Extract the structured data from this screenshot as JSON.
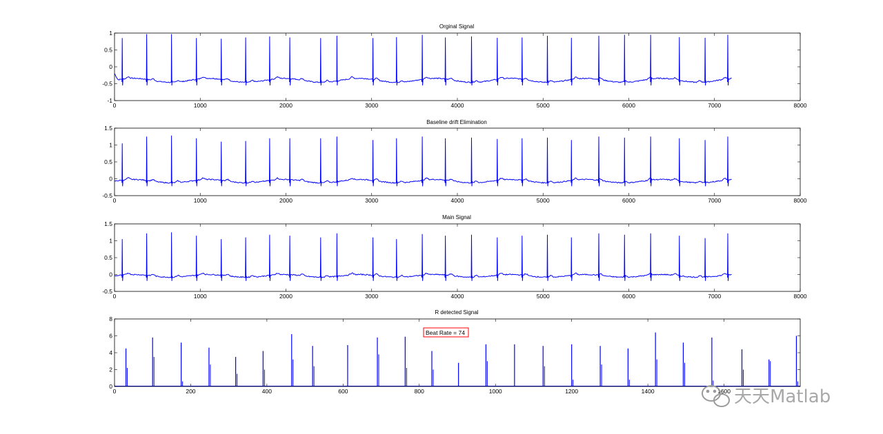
{
  "chart_data": [
    {
      "type": "line",
      "title": "Orginal Signal",
      "xlim": [
        0,
        8000
      ],
      "ylim": [
        -1,
        1
      ],
      "xticks": [
        0,
        1000,
        2000,
        3000,
        4000,
        5000,
        6000,
        7000,
        8000
      ],
      "yticks": [
        -1,
        -0.5,
        0,
        0.5,
        1
      ],
      "series_color": "#0000ff",
      "signal": {
        "x_end": 7200,
        "r_peaks_x": [
          90,
          375,
          665,
          955,
          1245,
          1530,
          1810,
          2045,
          2405,
          2595,
          3015,
          3290,
          3590,
          3860,
          4165,
          4465,
          4755,
          5050,
          5330,
          5650,
          5950,
          6255,
          6590,
          6890,
          7155
        ],
        "r_peaks_y": [
          0.85,
          0.97,
          0.97,
          0.85,
          0.83,
          0.87,
          0.9,
          0.87,
          0.85,
          0.92,
          0.85,
          0.88,
          0.95,
          0.87,
          0.9,
          0.86,
          0.87,
          0.92,
          0.86,
          0.92,
          0.95,
          0.95,
          0.88,
          0.86,
          0.95
        ],
        "baseline": -0.4,
        "baseline_drift": 0.06
      }
    },
    {
      "type": "line",
      "title": "Baseline drift Elimination",
      "xlim": [
        0,
        8000
      ],
      "ylim": [
        -0.5,
        1.5
      ],
      "xticks": [
        0,
        1000,
        2000,
        3000,
        4000,
        5000,
        6000,
        7000,
        8000
      ],
      "yticks": [
        -0.5,
        0,
        0.5,
        1,
        1.5
      ],
      "series_color": "#0000ff",
      "signal": {
        "x_end": 7200,
        "r_peaks_x": [
          90,
          375,
          665,
          955,
          1245,
          1530,
          1810,
          2045,
          2405,
          2595,
          3015,
          3290,
          3590,
          3860,
          4165,
          4465,
          4755,
          5050,
          5330,
          5650,
          5950,
          6255,
          6590,
          6890,
          7155
        ],
        "r_peaks_y": [
          1.05,
          1.25,
          1.28,
          1.2,
          1.1,
          1.12,
          1.2,
          1.2,
          1.2,
          1.25,
          1.15,
          1.2,
          1.25,
          1.2,
          1.22,
          1.18,
          1.2,
          1.22,
          1.15,
          1.25,
          1.22,
          1.25,
          1.2,
          1.15,
          1.25
        ],
        "baseline": -0.07,
        "baseline_drift": 0.05
      }
    },
    {
      "type": "line",
      "title": "Main Signal",
      "xlim": [
        0,
        8000
      ],
      "ylim": [
        -0.5,
        1.5
      ],
      "xticks": [
        0,
        1000,
        2000,
        3000,
        4000,
        5000,
        6000,
        7000,
        8000
      ],
      "yticks": [
        -0.5,
        0,
        0.5,
        1,
        1.5
      ],
      "series_color": "#0000ff",
      "signal": {
        "x_end": 7200,
        "r_peaks_x": [
          90,
          375,
          665,
          955,
          1245,
          1530,
          1810,
          2045,
          2405,
          2595,
          3015,
          3290,
          3590,
          3860,
          4165,
          4465,
          4755,
          5050,
          5330,
          5650,
          5950,
          6255,
          6590,
          6890,
          7155
        ],
        "r_peaks_y": [
          1.05,
          1.22,
          1.25,
          1.15,
          1.05,
          1.1,
          1.18,
          1.15,
          1.1,
          1.22,
          1.1,
          1.05,
          1.2,
          1.15,
          1.18,
          1.1,
          1.15,
          1.18,
          1.1,
          1.22,
          1.18,
          1.22,
          1.15,
          1.08,
          1.22
        ],
        "baseline": -0.04,
        "baseline_drift": 0.04
      }
    },
    {
      "type": "stem",
      "title": "R detected Signal",
      "xlim": [
        0,
        1800
      ],
      "ylim": [
        0,
        8
      ],
      "xticks": [
        0,
        200,
        400,
        600,
        800,
        1000,
        1200,
        1400,
        1600
      ],
      "xtick_labels": [
        "0",
        "200",
        "400",
        "600",
        "800",
        "1000",
        "1200",
        "1400",
        "1600",
        ""
      ],
      "yticks": [
        0,
        2,
        4,
        6,
        8
      ],
      "series_color": "#0000ff",
      "stems": {
        "x": [
          30,
          100,
          175,
          248,
          318,
          390,
          465,
          520,
          612,
          690,
          763,
          833,
          903,
          975,
          1050,
          1125,
          1200,
          1275,
          1348,
          1420,
          1493,
          1568,
          1647,
          1718,
          1790
        ],
        "y": [
          4.5,
          5.8,
          5.2,
          4.6,
          3.5,
          4.2,
          6.2,
          4.8,
          4.9,
          5.8,
          5.9,
          4.2,
          2.8,
          5.0,
          5.0,
          4.8,
          5.0,
          4.8,
          4.5,
          6.4,
          5.2,
          5.8,
          4.4,
          3.2,
          6.0
        ],
        "step_y": [
          2.2,
          3.5,
          0.6,
          2.6,
          1.5,
          2.0,
          3.2,
          2.4,
          0,
          3.8,
          2.2,
          2.0,
          0,
          3.0,
          0,
          2.4,
          0.8,
          2.6,
          0.8,
          3.2,
          2.8,
          0.7,
          2.0,
          3.0,
          0.6
        ]
      },
      "annotation": "Beat Rate = 74"
    }
  ],
  "watermark": "天天Matlab"
}
